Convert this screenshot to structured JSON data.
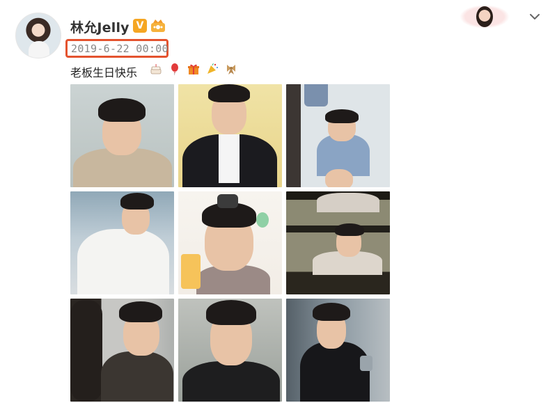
{
  "post": {
    "username": "林允Jelly",
    "verified_badge": "V",
    "timestamp": "2019-6-22 00:00",
    "text": "老板生日快乐",
    "emojis": [
      "cake-emoji",
      "balloon-emoji",
      "gift-emoji",
      "party-popper-emoji",
      "ribbon-emoji"
    ],
    "colors": {
      "highlight": "#e4532f",
      "badge": "#f5a623",
      "timestamp": "#888888"
    },
    "photos": [
      {
        "name": "photo-1"
      },
      {
        "name": "photo-2"
      },
      {
        "name": "photo-3"
      },
      {
        "name": "photo-4"
      },
      {
        "name": "photo-5"
      },
      {
        "name": "photo-6"
      },
      {
        "name": "photo-7"
      },
      {
        "name": "photo-8"
      },
      {
        "name": "photo-9"
      }
    ]
  }
}
